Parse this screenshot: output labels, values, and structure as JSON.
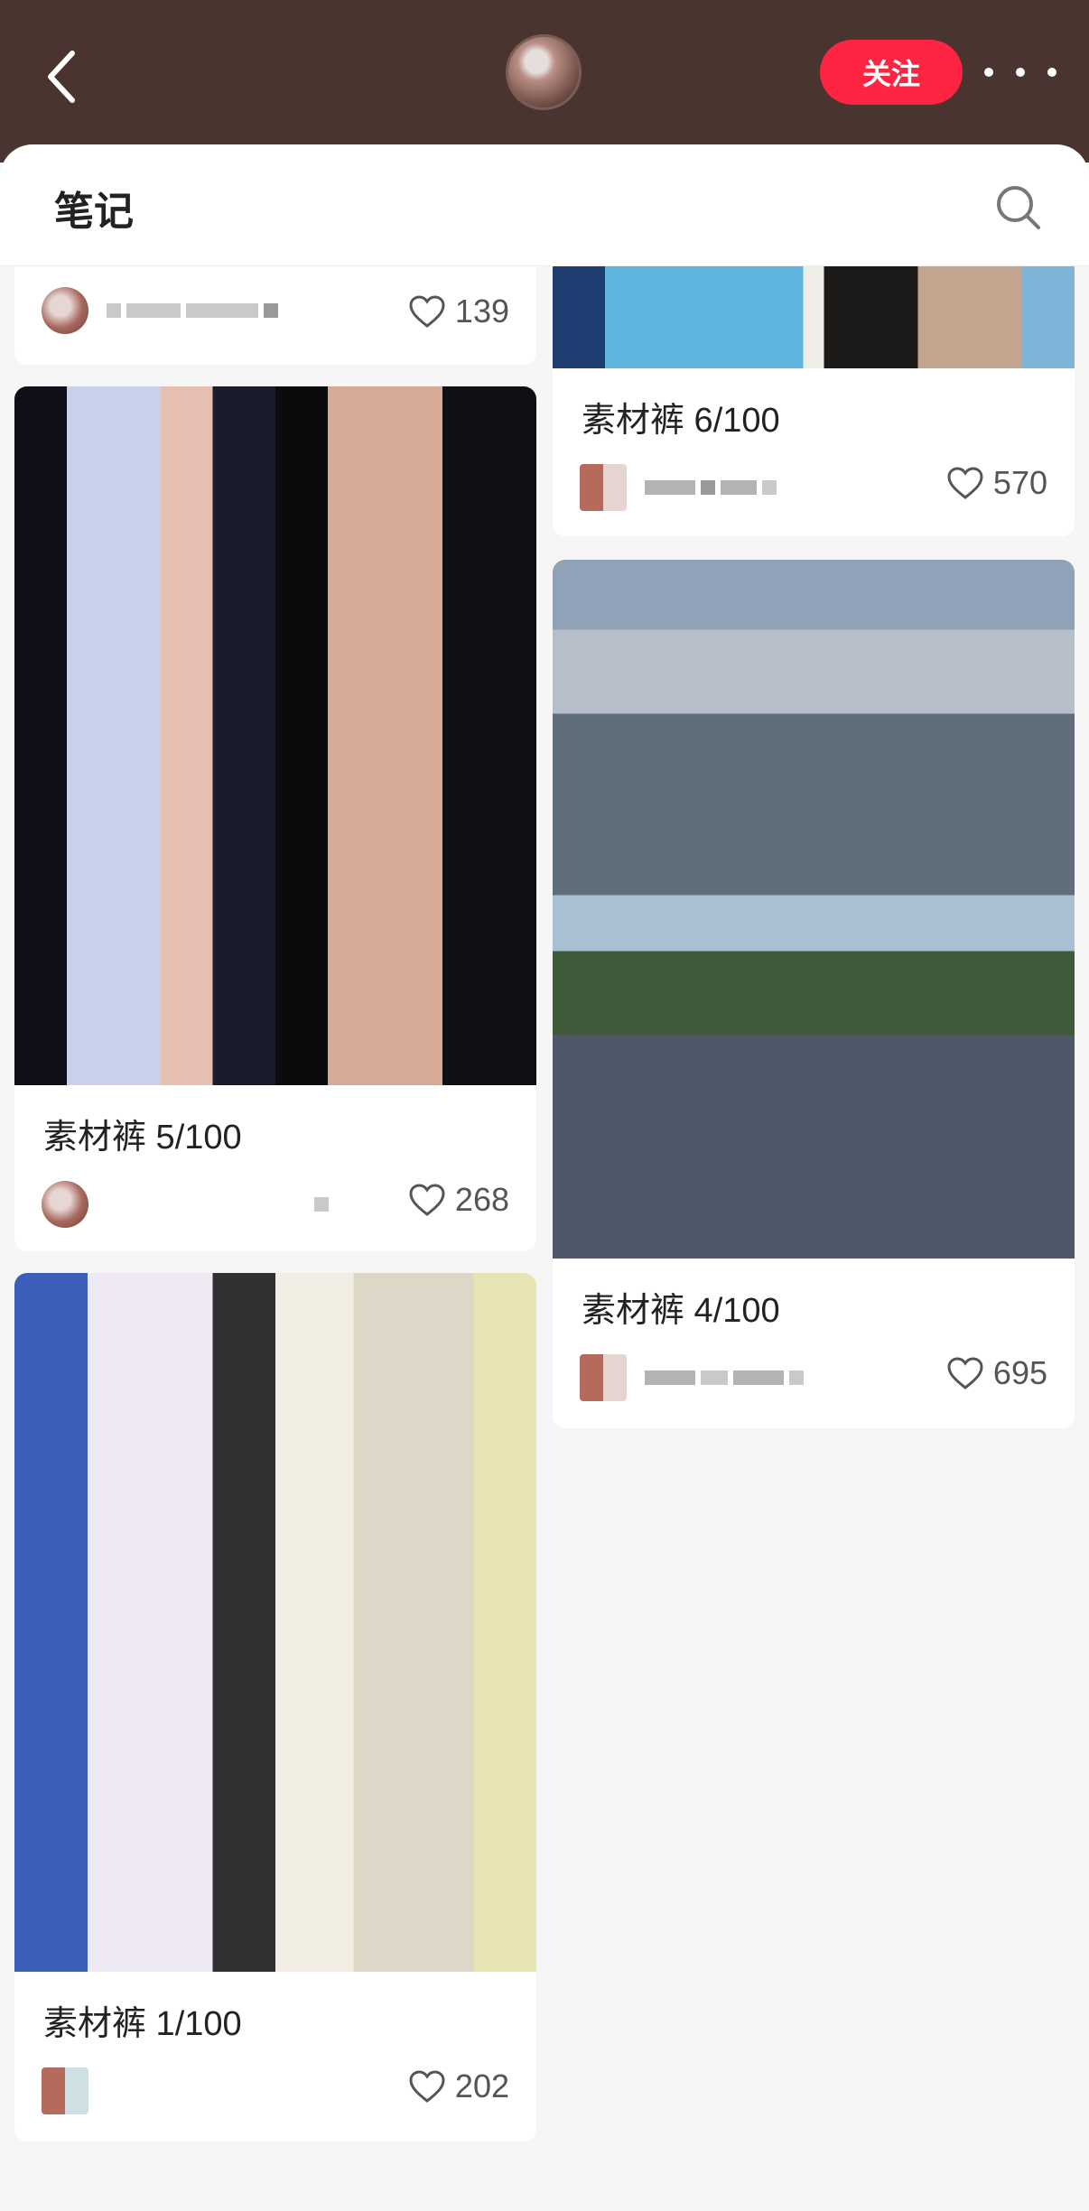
{
  "header": {
    "follow_label": "关注",
    "tab_title": "笔记"
  },
  "icons": {
    "back": "back-arrow-icon",
    "more": "more-dots-icon",
    "search": "search-icon",
    "like": "heart-icon"
  },
  "colors": {
    "topbar_bg": "#4a3430",
    "follow_bg": "#ff2442"
  },
  "notes": [
    {
      "id": "partial-top",
      "title": "",
      "likes": "139"
    },
    {
      "id": "note-6",
      "title": "素材裤 6/100",
      "likes": "570"
    },
    {
      "id": "note-5",
      "title": "素材裤 5/100",
      "likes": "268"
    },
    {
      "id": "note-4",
      "title": "素材裤 4/100",
      "likes": "695"
    },
    {
      "id": "note-1",
      "title": "素材裤 1/100",
      "likes": "202"
    }
  ]
}
